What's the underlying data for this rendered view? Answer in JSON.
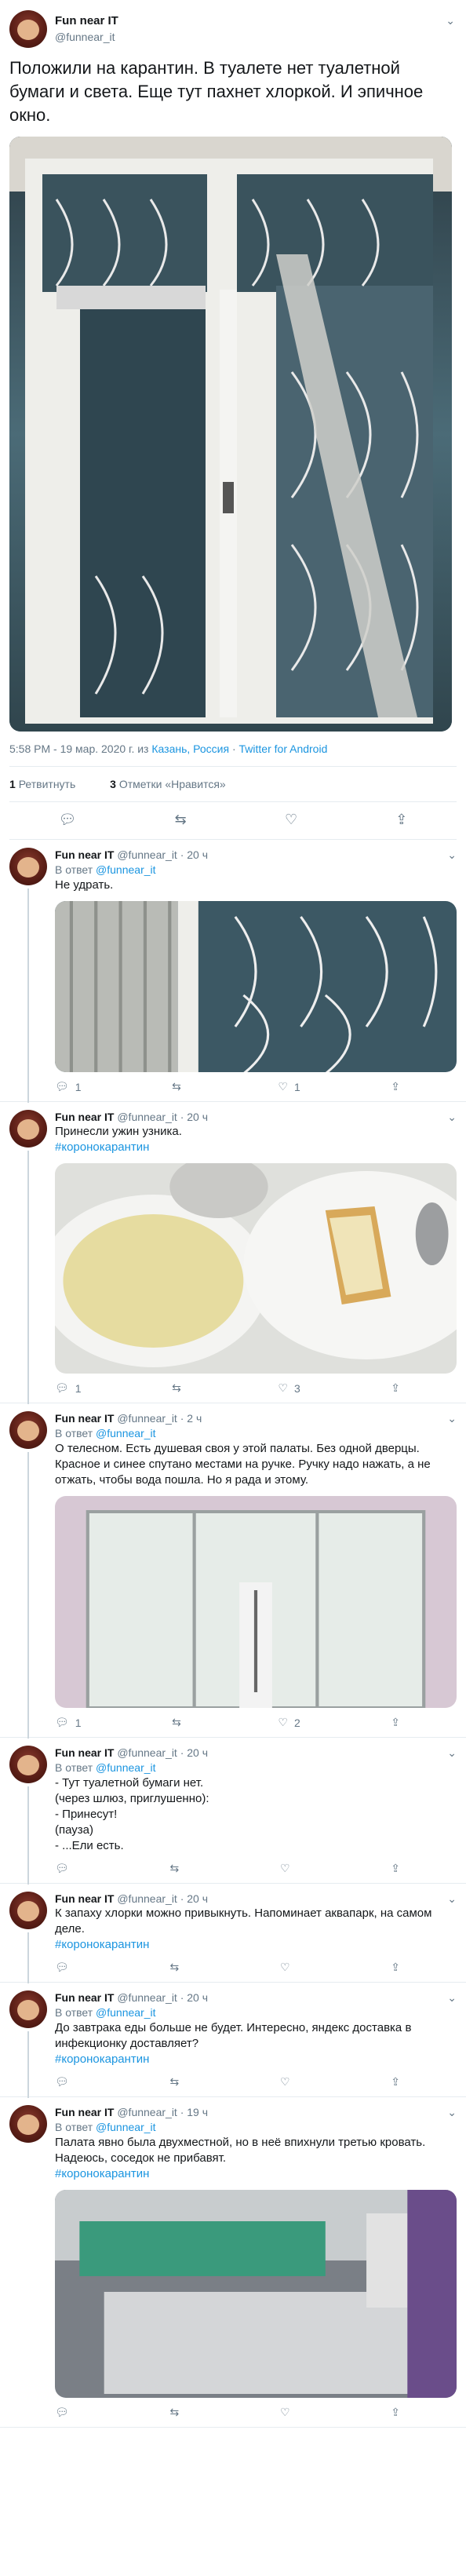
{
  "user": {
    "display_name": "Fun near IT",
    "handle": "@funnear_it"
  },
  "main_tweet": {
    "text": "Положили на карантин. В туалете нет туалетной бумаги и света. Еще тут пахнет хлоркой. И эпичное окно.",
    "time_date": "5:58 PM - 19 мар. 2020 г. из ",
    "location": "Казань, Россия",
    "separator": " · ",
    "source": "Twitter for Android",
    "retweets_count": "1",
    "retweets_label": "Ретвитнуть",
    "likes_count": "3",
    "likes_label": "Отметки «Нравится»"
  },
  "reply_prefix": "В ответ",
  "replies": [
    {
      "time": "· 20 ч",
      "reply_to": "@funnear_it",
      "text": "Не удрать.",
      "tags": "",
      "reply_count": "1",
      "retweet_count": "",
      "like_count": "1"
    },
    {
      "time": "· 20 ч",
      "reply_to": "",
      "text": "Принесли ужин узника.",
      "tags": "#коронокарантин",
      "reply_count": "1",
      "retweet_count": "",
      "like_count": "3"
    },
    {
      "time": "· 2 ч",
      "reply_to": "@funnear_it",
      "text": "О телесном. Есть душевая своя у этой палаты. Без одной дверцы. Красное и синее спутано местами на ручке. Ручку надо нажать, а не отжать, чтобы вода пошла. Но я рада и этому.",
      "tags": "",
      "reply_count": "1",
      "retweet_count": "",
      "like_count": "2"
    },
    {
      "time": "· 20 ч",
      "reply_to": "@funnear_it",
      "text": "- Тут туалетной бумаги нет.\n(через шлюз, приглушенно):\n-  Принесут!\n(пауза)\n- ...Ели есть.",
      "tags": "",
      "reply_count": "",
      "retweet_count": "",
      "like_count": ""
    },
    {
      "time": "· 20 ч",
      "reply_to": "",
      "text": "К запаху хлорки можно привыкнуть. Напоминает аквапарк, на самом деле.",
      "tags": "#коронокарантин",
      "reply_count": "",
      "retweet_count": "",
      "like_count": ""
    },
    {
      "time": "· 20 ч",
      "reply_to": "@funnear_it",
      "text": "До завтрака еды больше не будет. Интересно, яндекс доставка в инфекционку доставляет?",
      "tags": "#коронокарантин",
      "reply_count": "",
      "retweet_count": "",
      "like_count": ""
    },
    {
      "time": "· 19 ч",
      "reply_to": "@funnear_it",
      "text": "Палата явно была двухместной, но в неё впихнули третью кровать. Надеюсь, соседок не прибавят.",
      "tags": "#коронокарантин",
      "reply_count": "",
      "retweet_count": "",
      "like_count": ""
    }
  ],
  "colors": {
    "link": "#1b95e0",
    "muted": "#657786",
    "border": "#e6ecf0"
  }
}
